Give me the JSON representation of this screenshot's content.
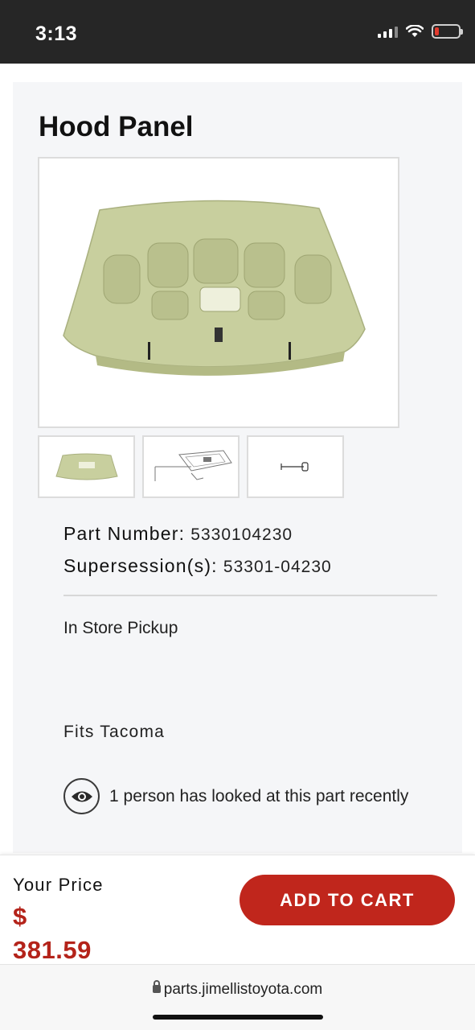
{
  "status_bar": {
    "time": "3:13"
  },
  "product": {
    "title": "Hood Panel",
    "part_number_label": "Part Number:",
    "part_number": "5330104230",
    "supersession_label": "Supersession(s):",
    "supersession": "53301-04230",
    "pickup": "In Store Pickup",
    "fits": "Fits Tacoma",
    "views_text": "1 person has looked at this part recently"
  },
  "price_bar": {
    "label": "Your Price",
    "currency": "$",
    "amount": "381.59",
    "cart_button": "ADD TO CART"
  },
  "browser": {
    "url": "parts.jimellistoyota.com"
  },
  "colors": {
    "accent": "#c0261c",
    "price": "#b4231a",
    "part_color": "#c8cf9e"
  },
  "icons": [
    "wifi-icon",
    "signal-icon",
    "battery-icon",
    "eye-icon",
    "lock-icon"
  ]
}
